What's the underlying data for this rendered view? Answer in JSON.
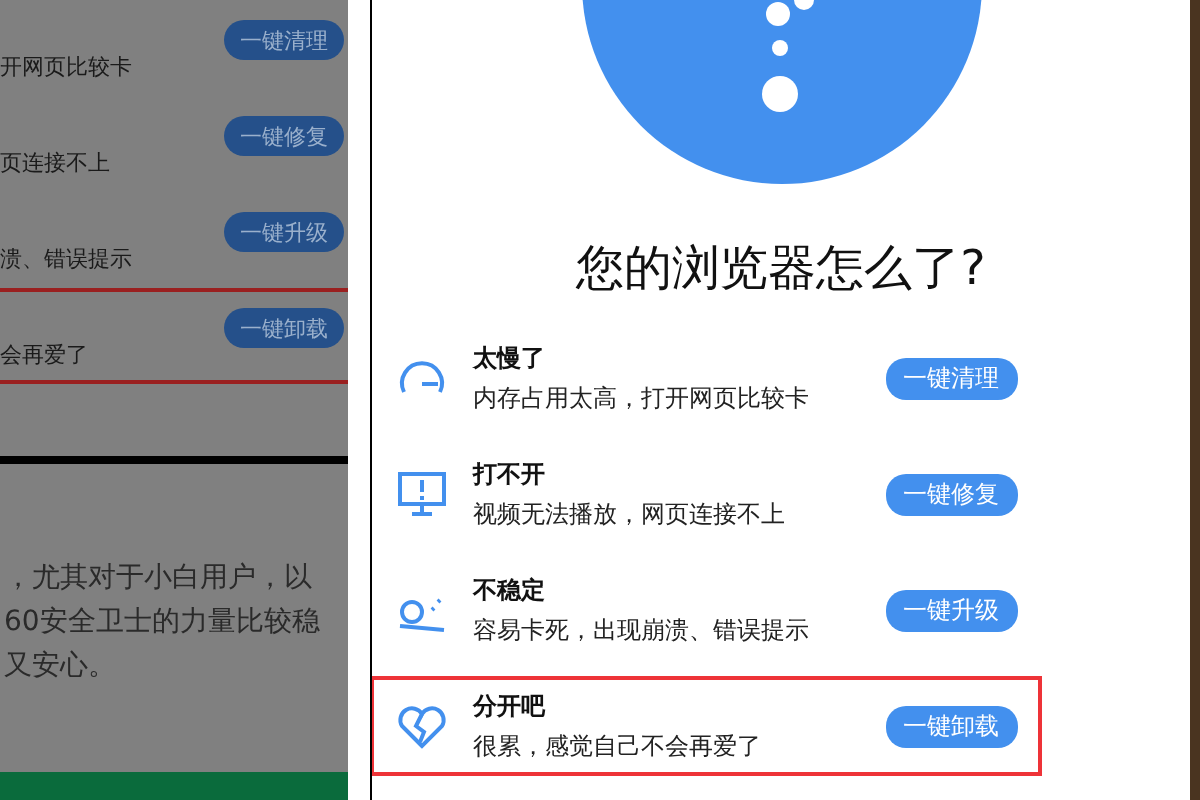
{
  "background_page": {
    "rows": [
      {
        "text": "开网页比较卡",
        "button": "一键清理",
        "selected": false
      },
      {
        "text": "页连接不上",
        "button": "一键修复",
        "selected": false
      },
      {
        "text": "溃、错误提示",
        "button": "一键升级",
        "selected": false
      },
      {
        "text": "会再爱了",
        "button": "一键卸载",
        "selected": true
      }
    ],
    "paragraph": [
      "，尤其对于小白用户，以",
      "60安全卫士的力量比较稳",
      "又安心。"
    ]
  },
  "dialog": {
    "title": "您的浏览器怎么了?",
    "items": [
      {
        "kind": "speed",
        "title": "太慢了",
        "description": "内存占用太高，打开网页比较卡",
        "button": "一键清理",
        "selected": false
      },
      {
        "kind": "monitor",
        "title": "打不开",
        "description": "视频无法播放，网页连接不上",
        "button": "一键修复",
        "selected": false
      },
      {
        "kind": "unstable",
        "title": "不稳定",
        "description": "容易卡死，出现崩溃、错误提示",
        "button": "一键升级",
        "selected": false
      },
      {
        "kind": "heart",
        "title": "分开吧",
        "description": "很累，感觉自己不会再爱了",
        "button": "一键卸载",
        "selected": true
      }
    ]
  }
}
